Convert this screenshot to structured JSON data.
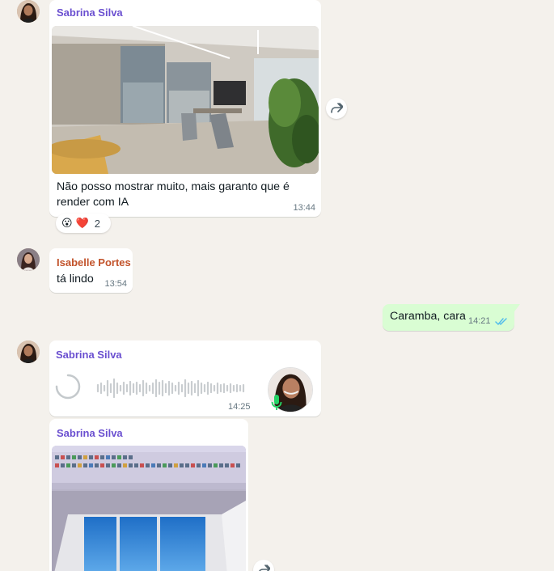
{
  "colors": {
    "chat_background": "#f4f1ec",
    "incoming_bubble": "#ffffff",
    "outgoing_bubble": "#d9fdd3",
    "sabrina_name": "#6a4fd0",
    "isabelle_name": "#c2532b",
    "read_ticks": "#53bdeb",
    "mic_green": "#25d366"
  },
  "messages": [
    {
      "sender": "Sabrina Silva",
      "type": "image",
      "caption": "Não posso mostrar muito, mais garanto que é render com IA",
      "time": "13:44",
      "reactions": {
        "emojis": [
          "😮",
          "❤️"
        ],
        "count": "2"
      },
      "icons": [
        "forward-icon"
      ]
    },
    {
      "sender": "Isabelle Portes",
      "type": "text",
      "text": "tá lindo",
      "time": "13:54"
    },
    {
      "sender": "me",
      "type": "text",
      "text": "Caramba, cara",
      "time": "14:21",
      "status_icon": "double-check-icon"
    },
    {
      "sender": "Sabrina Silva",
      "type": "voice",
      "time": "14:25",
      "icons": [
        "loading-spinner-icon",
        "microphone-icon"
      ]
    },
    {
      "sender": "Sabrina Silva",
      "type": "image",
      "icons": [
        "forward-icon"
      ]
    }
  ]
}
